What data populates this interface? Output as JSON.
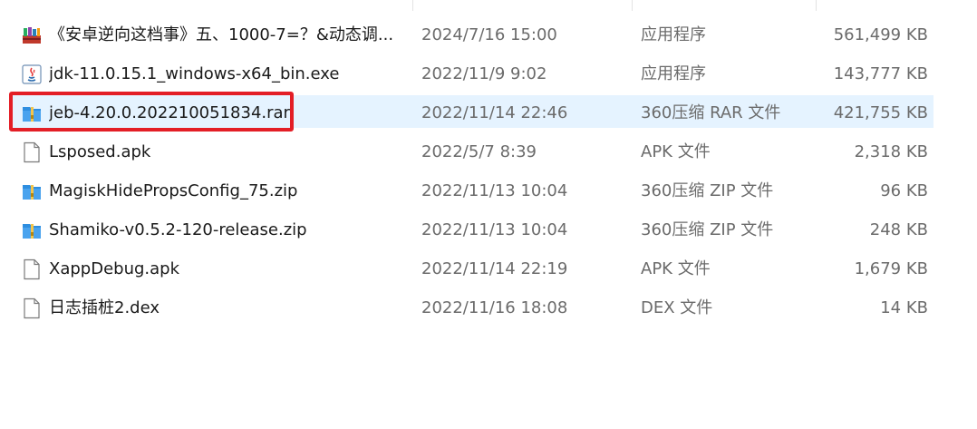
{
  "files": [
    {
      "name": "《安卓逆向这档事》五、1000-7=？&动态调...",
      "date": "2024/7/16 15:00",
      "type": "应用程序",
      "size": "561,499 KB",
      "icon": "books-app-icon"
    },
    {
      "name": "jdk-11.0.15.1_windows-x64_bin.exe",
      "date": "2022/11/9 9:02",
      "type": "应用程序",
      "size": "143,777 KB",
      "icon": "java-installer-icon"
    },
    {
      "name": "jeb-4.20.0.202210051834.rar",
      "date": "2022/11/14 22:46",
      "type": "360压缩 RAR 文件",
      "size": "421,755 KB",
      "icon": "archive-icon",
      "selected": true
    },
    {
      "name": "Lsposed.apk",
      "date": "2022/5/7 8:39",
      "type": "APK 文件",
      "size": "2,318 KB",
      "icon": "document-icon"
    },
    {
      "name": "MagiskHidePropsConfig_75.zip",
      "date": "2022/11/13 10:04",
      "type": "360压缩 ZIP 文件",
      "size": "96 KB",
      "icon": "archive-icon"
    },
    {
      "name": "Shamiko-v0.5.2-120-release.zip",
      "date": "2022/11/13 10:04",
      "type": "360压缩 ZIP 文件",
      "size": "248 KB",
      "icon": "archive-icon"
    },
    {
      "name": "XappDebug.apk",
      "date": "2022/11/14 22:19",
      "type": "APK 文件",
      "size": "1,679 KB",
      "icon": "document-icon"
    },
    {
      "name": "日志插桩2.dex",
      "date": "2022/11/16 18:08",
      "type": "DEX 文件",
      "size": "14 KB",
      "icon": "document-icon"
    }
  ],
  "colors": {
    "selection": "#e5f3ff",
    "highlight": "#e31e26",
    "archive_blue": "#2e8ee0",
    "archive_zipper": "#f4c54a"
  }
}
